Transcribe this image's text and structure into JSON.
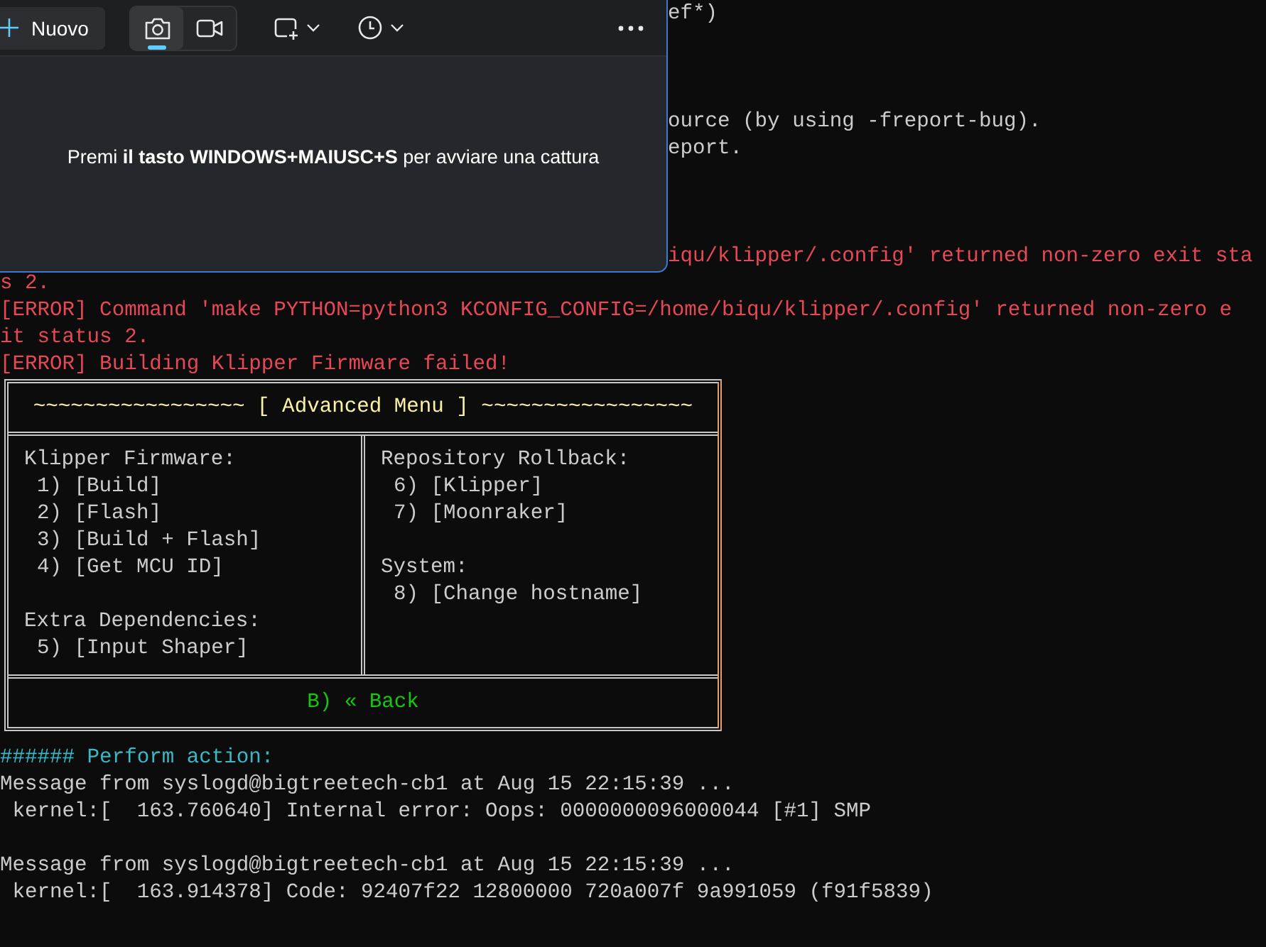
{
  "snipping_tool": {
    "new_button": "Nuovo",
    "modes": [
      {
        "kind": "photo",
        "selected": true
      },
      {
        "kind": "video",
        "selected": false
      }
    ],
    "hint": "Premi **il tasto WINDOWS+MAIUSC+S** per avviare una cattura"
  },
  "terminal": {
    "beside_window": [
      {
        "kind": "normal",
        "text": "ef*)"
      },
      {
        "kind": "blank"
      },
      {
        "kind": "blank"
      },
      {
        "kind": "blank"
      },
      {
        "kind": "normal",
        "text": "ource (by using -freport-bug)."
      },
      {
        "kind": "normal",
        "text": "eport."
      },
      {
        "kind": "blank"
      },
      {
        "kind": "blank"
      },
      {
        "kind": "blank"
      },
      {
        "kind": "error",
        "text": "iqu/klipper/.config' returned non-zero exit sta"
      }
    ],
    "lines_before": [
      {
        "kind": "error",
        "text": "s 2."
      },
      {
        "kind": "error",
        "text": "[ERROR] Command 'make PYTHON=python3 KCONFIG_CONFIG=/home/biqu/klipper/.config' returned non-zero e"
      },
      {
        "kind": "error",
        "text": "it status 2."
      },
      {
        "kind": "error",
        "text": "[ERROR] Building Klipper Firmware failed!"
      }
    ],
    "menu": {
      "title": "~~~~~~~~~~~~~~~~~ [ Advanced Menu ] ~~~~~~~~~~~~~~~~~",
      "columns": [
        [
          {
            "heading": "Klipper Firmware:",
            "items": [
              "1) [Build]",
              "2) [Flash]",
              "3) [Build + Flash]",
              "4) [Get MCU ID]"
            ]
          },
          {
            "heading": "Extra Dependencies:",
            "items": [
              "5) [Input Shaper]"
            ]
          }
        ],
        [
          {
            "heading": "Repository Rollback:",
            "items": [
              "6) [Klipper]",
              "7) [Moonraker]"
            ]
          },
          {
            "heading": "System:",
            "items": [
              "8) [Change hostname]"
            ]
          }
        ]
      ],
      "back": "B) « Back"
    },
    "lines_after": [
      {
        "kind": "prompt",
        "text": "###### Perform action:"
      },
      {
        "kind": "normal",
        "text": "Message from syslogd@bigtreetech-cb1 at Aug 15 22:15:39 ..."
      },
      {
        "kind": "normal",
        "text": " kernel:[  163.760640] Internal error: Oops: 0000000096000044 [#1] SMP"
      },
      {
        "kind": "blank"
      },
      {
        "kind": "normal",
        "text": "Message from syslogd@bigtreetech-cb1 at Aug 15 22:15:39 ..."
      },
      {
        "kind": "normal",
        "text": " kernel:[  163.914378] Code: 92407f22 12800000 720a007f 9a991059 (f91f5839)"
      }
    ]
  }
}
